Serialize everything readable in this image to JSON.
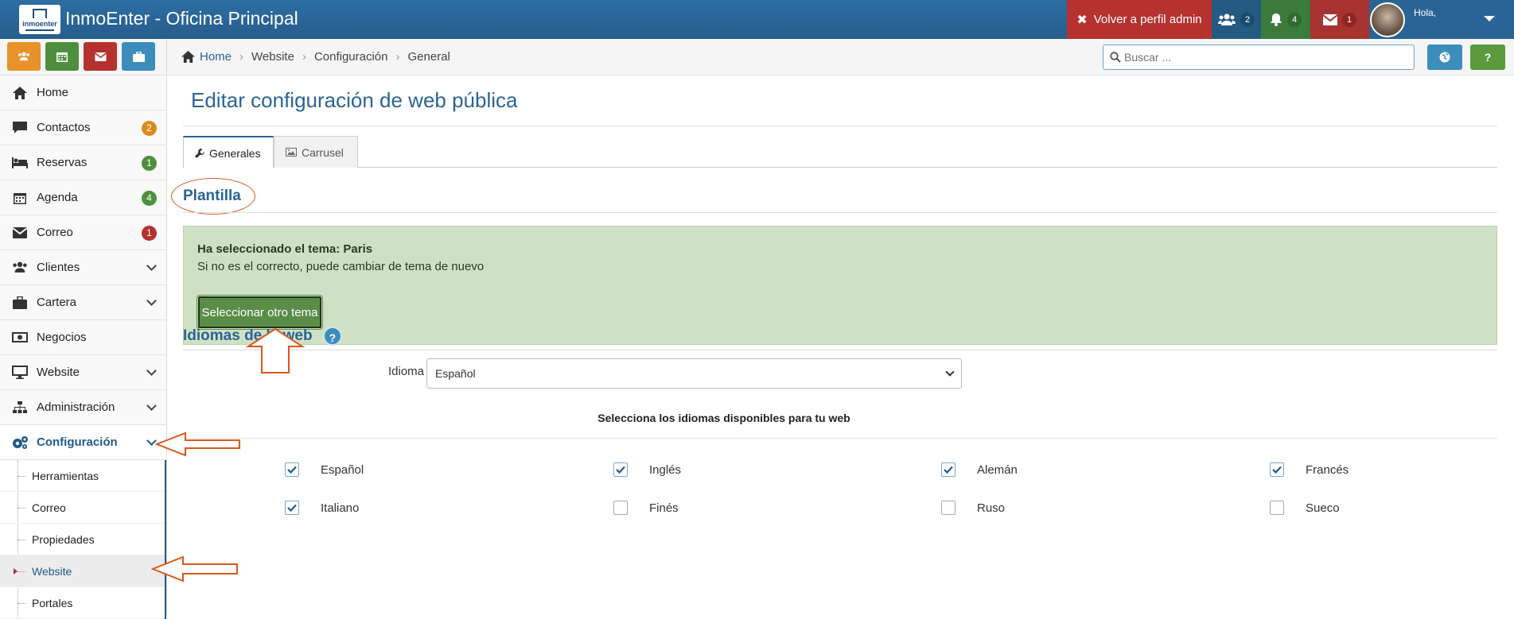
{
  "topbar": {
    "logo_text": "inmoenter",
    "app_title": "InmoEnter - Oficina Principal",
    "admin_button": "Volver a perfil admin",
    "users_count": "2",
    "notifications_count": "4",
    "mail_count": "1",
    "greeting": "Hola,"
  },
  "sidebar": {
    "items": [
      {
        "label": "Home"
      },
      {
        "label": "Contactos",
        "badge": "2"
      },
      {
        "label": "Reservas",
        "badge": "1"
      },
      {
        "label": "Agenda",
        "badge": "4"
      },
      {
        "label": "Correo",
        "badge": "1"
      },
      {
        "label": "Clientes"
      },
      {
        "label": "Cartera"
      },
      {
        "label": "Negocios"
      },
      {
        "label": "Website"
      },
      {
        "label": "Administración"
      },
      {
        "label": "Configuración"
      }
    ],
    "subitems": [
      "Herramientas",
      "Correo",
      "Propiedades",
      "Website",
      "Portales"
    ]
  },
  "breadcrumb": {
    "items": [
      "Home",
      "Website",
      "Configuración",
      "General"
    ]
  },
  "search": {
    "placeholder": "Buscar ..."
  },
  "help_button": "?",
  "page": {
    "title": "Editar configuración de web pública",
    "tabs": [
      "Generales",
      "Carrusel"
    ],
    "template_section": "Plantilla",
    "alert_line1": "Ha seleccionado el tema: Paris",
    "alert_line2": "Si no es el correcto, puede cambiar de tema de nuevo",
    "select_theme_button": "Seleccionar otro tema",
    "languages_section": "Idiomas de la web",
    "languages_help": "?",
    "default_language_label": "Idioma por defecto",
    "required_mark": "*",
    "default_language_value": "Español",
    "available_heading": "Selecciona los idiomas disponibles para tu web",
    "languages": [
      {
        "name": "Español",
        "checked": true
      },
      {
        "name": "Inglés",
        "checked": true
      },
      {
        "name": "Alemán",
        "checked": true
      },
      {
        "name": "Francés",
        "checked": true
      },
      {
        "name": "Italiano",
        "checked": true
      },
      {
        "name": "Finés",
        "checked": false
      },
      {
        "name": "Ruso",
        "checked": false
      },
      {
        "name": "Sueco",
        "checked": false
      }
    ]
  },
  "colors": {
    "primary": "#2a6496",
    "danger": "#b5322f",
    "success": "#4e8f3e",
    "warning": "#d98a1e",
    "alert_bg": "#cfe1c5",
    "annotation": "#d9581c"
  }
}
